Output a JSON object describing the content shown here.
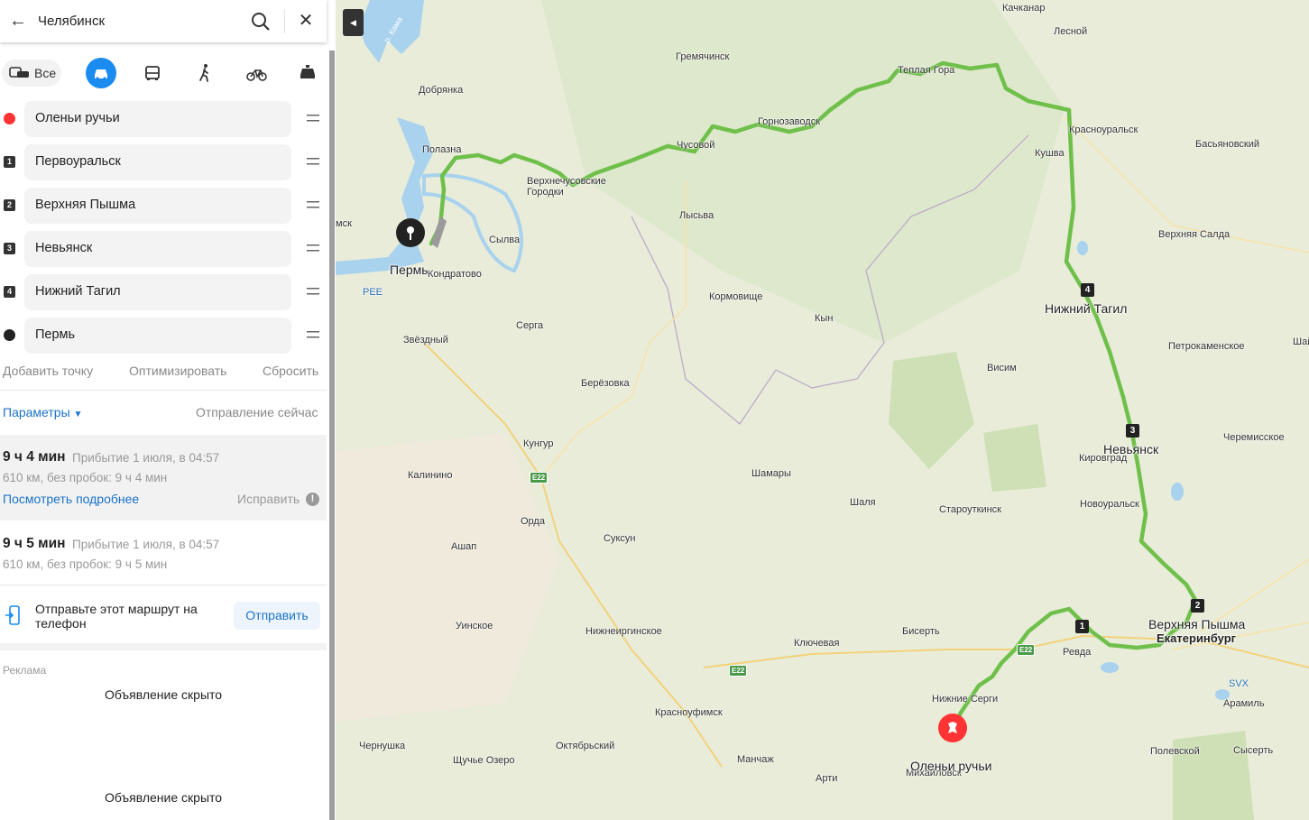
{
  "search": {
    "value": "Челябинск"
  },
  "modes": {
    "all_label": "Все"
  },
  "route_points": [
    {
      "label": "Оленьи ручьи",
      "marker": ""
    },
    {
      "label": "Первоуральск",
      "marker": "1"
    },
    {
      "label": "Верхняя Пышма",
      "marker": "2"
    },
    {
      "label": "Невьянск",
      "marker": "3"
    },
    {
      "label": "Нижний Тагил",
      "marker": "4"
    },
    {
      "label": "Пермь",
      "marker": ""
    }
  ],
  "actions": {
    "add": "Добавить точку",
    "optimize": "Оптимизировать",
    "reset": "Сбросить"
  },
  "params": {
    "label": "Параметры",
    "depart": "Отправление сейчас"
  },
  "routes": [
    {
      "time": "9 ч 4 мин",
      "arrival": "Прибытие 1 июля, в 04:57",
      "dist": "610 км, без пробок: 9 ч 4 мин",
      "details": "Посмотреть подробнее",
      "fix": "Исправить"
    },
    {
      "time": "9 ч 5 мин",
      "arrival": "Прибытие 1 июля, в 04:57",
      "dist": "610 км, без пробок: 9 ч 5 мин"
    }
  ],
  "send": {
    "text": "Отправьте этот маршрут на телефон",
    "button": "Отправить"
  },
  "ads": {
    "label": "Реклама",
    "hidden": "Объявление скрыто"
  },
  "colors": {
    "route": "#6fc04a",
    "accent": "#1a8cf0",
    "link": "#1a73c9",
    "start": "#ff3333"
  },
  "map": {
    "cities": {
      "perm": "Пермь",
      "tagil": "Нижний Тагил",
      "nevyansk": "Невьянск",
      "pyshma": "Верхняя Пышма",
      "ekb": "Екатеринбург",
      "olenyi": "Оленьи ручьи"
    },
    "towns": {
      "kachkanar": "Качканар",
      "lesnoy": "Лесной",
      "kama": "р. Кама",
      "gremyachinsk": "Гремячинск",
      "dobryanka": "Добрянка",
      "teplaya": "Теплая Гора",
      "polazna": "Полазна",
      "gornozavodsk": "Горнозаводск",
      "krasnouralsk": "Красноуральск",
      "basyanovsky": "Басьяновский",
      "chusovoy": "Чусовой",
      "vgorodki": "Верхнечусовские Городки",
      "kushva": "Кушва",
      "msk": "мск",
      "lysva": "Лысьва",
      "sylva": "Сылва",
      "vsalda": "Верхняя Салда",
      "pee": "PEE",
      "kondratovo": "Кондратово",
      "kormovische": "Кормовище",
      "serga": "Серга",
      "kyn": "Кын",
      "zvezdny": "Звёздный",
      "petrokamenskoe": "Петрокаменское",
      "sha": "Шай",
      "visim": "Висим",
      "berezovka": "Берёзовка",
      "kungur": "Кунгур",
      "cheremisskoe": "Черемисское",
      "kirovgrad": "Кировград",
      "kalinino": "Калинино",
      "shamary": "Шамары",
      "shalya": "Шаля",
      "novouralsk": "Новоуральск",
      "staroutkinsk": "Староуткинск",
      "orda": "Орда",
      "suksun": "Суксун",
      "ashap": "Ашап",
      "uinskoe": "Уинское",
      "nizhneirginskoe": "Нижнеиргинское",
      "klyuchevaya": "Ключевая",
      "bisert": "Бисерть",
      "revda": "Ревда",
      "svx": "SVX",
      "nizhnie_sergi": "Нижние Серги",
      "aramil": "Арамиль",
      "krasnoufimsk": "Красноуфимск",
      "chernushka": "Чернушка",
      "oktyabrsky": "Октябрьский",
      "schuchye": "Щучье Озеро",
      "manchazh": "Манчаж",
      "arti": "Арти",
      "mikhailovsk": "Михайловск",
      "polevskoy": "Полевской",
      "sysert": "Сысерть"
    },
    "highways": {
      "e22": "E22"
    }
  }
}
